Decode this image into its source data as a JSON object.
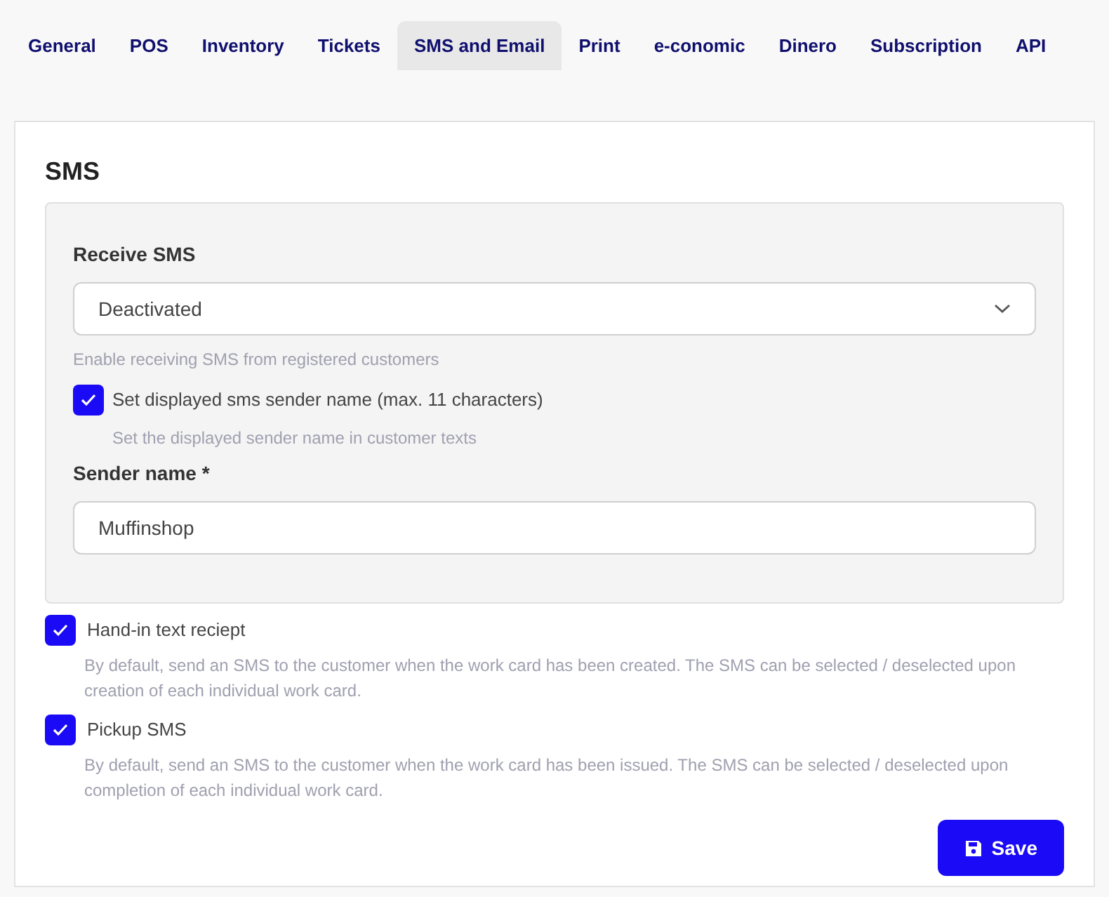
{
  "tabs": [
    {
      "label": "General",
      "selected": false
    },
    {
      "label": "POS",
      "selected": false
    },
    {
      "label": "Inventory",
      "selected": false
    },
    {
      "label": "Tickets",
      "selected": false
    },
    {
      "label": "SMS and Email",
      "selected": true
    },
    {
      "label": "Print",
      "selected": false
    },
    {
      "label": "e-conomic",
      "selected": false
    },
    {
      "label": "Dinero",
      "selected": false
    },
    {
      "label": "Subscription",
      "selected": false
    },
    {
      "label": "API",
      "selected": false
    }
  ],
  "section": {
    "title": "SMS",
    "receive": {
      "label": "Receive SMS",
      "value": "Deactivated",
      "help": "Enable receiving SMS from registered customers"
    },
    "sender_toggle": {
      "label": "Set displayed sms sender name (max. 11 characters)",
      "checked": true,
      "help": "Set the displayed sender name in customer texts"
    },
    "sender_name": {
      "label": "Sender name *",
      "value": "Muffinshop"
    },
    "options": [
      {
        "label": "Hand-in text reciept",
        "checked": true,
        "help": "By default, send an SMS to the customer when the work card has been created. The SMS can be selected / deselected upon creation of each individual work card."
      },
      {
        "label": "Pickup SMS",
        "checked": true,
        "help": "By default, send an SMS to the customer when the work card has been issued. The SMS can be selected / deselected upon completion of each individual work card."
      }
    ]
  },
  "save_button": "Save"
}
